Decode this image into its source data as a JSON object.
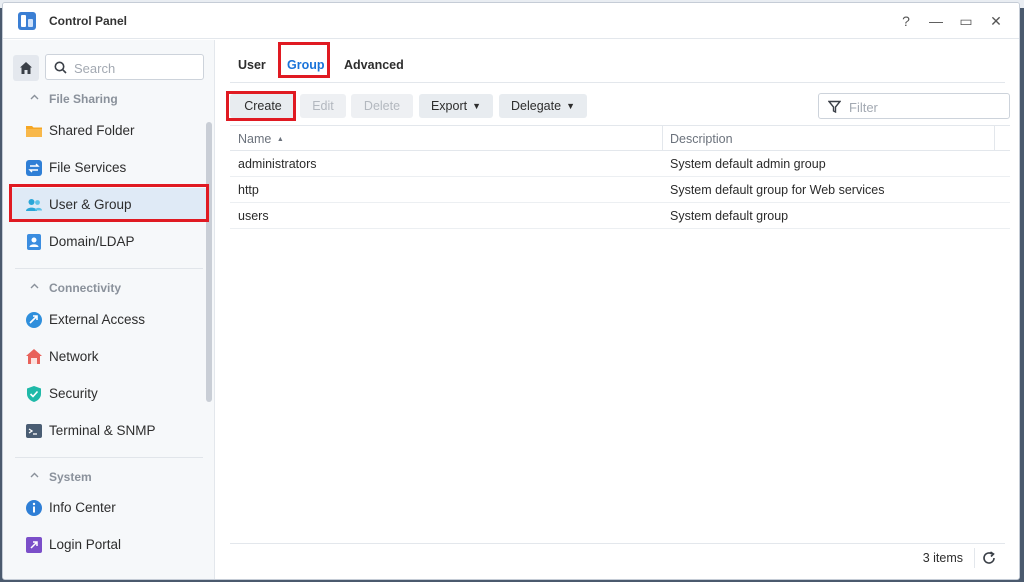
{
  "window": {
    "title": "Control Panel",
    "help_label": "?",
    "minimize_label": "—",
    "maximize_label": "▭",
    "close_label": "✕"
  },
  "sidebar": {
    "search_placeholder": "Search",
    "sections": [
      {
        "label": "File Sharing",
        "items": [
          {
            "label": "Shared Folder",
            "icon": "shared-folder-icon"
          },
          {
            "label": "File Services",
            "icon": "file-services-icon"
          },
          {
            "label": "User & Group",
            "icon": "user-group-icon",
            "active": true
          },
          {
            "label": "Domain/LDAP",
            "icon": "domain-ldap-icon"
          }
        ]
      },
      {
        "label": "Connectivity",
        "items": [
          {
            "label": "External Access",
            "icon": "external-access-icon"
          },
          {
            "label": "Network",
            "icon": "network-icon"
          },
          {
            "label": "Security",
            "icon": "security-shield-icon"
          },
          {
            "label": "Terminal & SNMP",
            "icon": "terminal-icon"
          }
        ]
      },
      {
        "label": "System",
        "items": [
          {
            "label": "Info Center",
            "icon": "info-icon"
          },
          {
            "label": "Login Portal",
            "icon": "login-portal-icon"
          }
        ]
      }
    ]
  },
  "tabs": [
    {
      "label": "User"
    },
    {
      "label": "Group",
      "active": true
    },
    {
      "label": "Advanced"
    }
  ],
  "toolbar": {
    "create_label": "Create",
    "edit_label": "Edit",
    "delete_label": "Delete",
    "export_label": "Export",
    "delegate_label": "Delegate",
    "filter_placeholder": "Filter"
  },
  "grid": {
    "columns": [
      "Name",
      "Description"
    ],
    "sort_indicator": "▲",
    "rows": [
      {
        "name": "administrators",
        "description": "System default admin group"
      },
      {
        "name": "http",
        "description": "System default group for Web services"
      },
      {
        "name": "users",
        "description": "System default group"
      }
    ]
  },
  "footer": {
    "count_label": "3 items"
  },
  "colors": {
    "accent": "#1a73d9",
    "highlight_box": "#e01a22",
    "active_nav_bg": "#dfeaf6"
  }
}
